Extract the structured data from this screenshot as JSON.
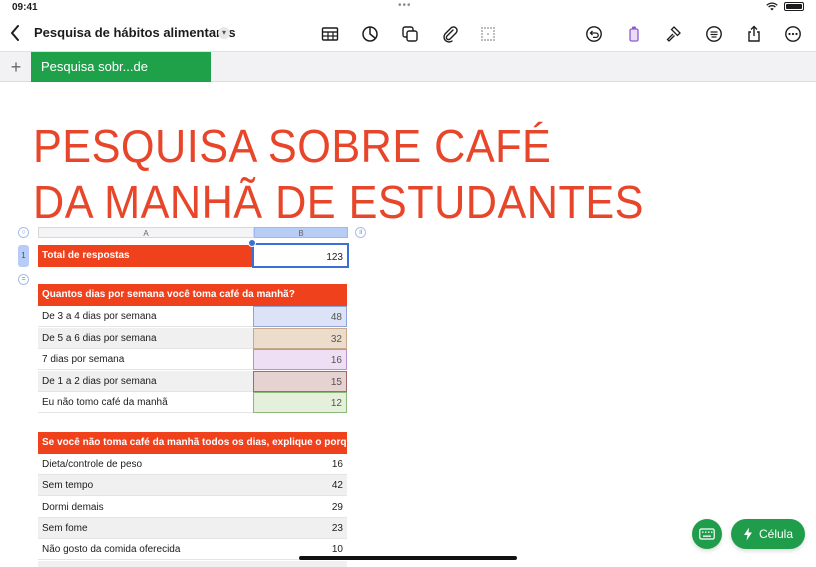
{
  "status": {
    "time": "09:41",
    "dots": "•••"
  },
  "toolbar": {
    "doc_title": "Pesquisa de hábitos alimentares",
    "icons": [
      "table-icon",
      "chart-icon",
      "shapes-icon",
      "attachment-icon",
      "grid-icon",
      "undo-icon",
      "format-brush-icon",
      "hammer-icon",
      "comment-list-icon",
      "share-icon",
      "more-icon"
    ]
  },
  "sheet": {
    "tab_label": "Pesquisa sobr...de estudantes"
  },
  "title": {
    "line1": "PESQUISA SOBRE CAFÉ",
    "line2": "DA MANHÃ DE ESTUDANTES"
  },
  "columns": {
    "a": "A",
    "b": "B",
    "row1": "1"
  },
  "table1": {
    "label": "Total de respostas",
    "value": "123"
  },
  "table2": {
    "header": "Quantos dias por semana você toma café da manhã?",
    "rows": [
      {
        "label": "De 3 a 4 dias por semana",
        "value": "48",
        "color": "#dde3f7",
        "border": "#8fa3d6"
      },
      {
        "label": "De 5 a 6 dias por semana",
        "value": "32",
        "color": "#ecdccb",
        "border": "#c9a98a"
      },
      {
        "label": "7 dias por semana",
        "value": "16",
        "color": "#efdff5",
        "border": "#b98fc8"
      },
      {
        "label": "De 1 a 2 dias por semana",
        "value": "15",
        "color": "#e6d2d0",
        "border": "#9e6b6b"
      },
      {
        "label": "Eu não tomo café da manhã",
        "value": "12",
        "color": "#e4f0dc",
        "border": "#8bb779"
      }
    ]
  },
  "table3": {
    "header": "Se você não toma café da manhã todos os dias, explique o porquê.",
    "rows": [
      {
        "label": "Dieta/controle de peso",
        "value": "16"
      },
      {
        "label": "Sem tempo",
        "value": "42"
      },
      {
        "label": "Dormi demais",
        "value": "29"
      },
      {
        "label": "Sem fome",
        "value": "23"
      },
      {
        "label": "Não gosto da comida oferecida",
        "value": "10"
      }
    ]
  },
  "actions": {
    "cell_label": "Célula"
  },
  "colors": {
    "accent_red": "#f0411d",
    "accent_green": "#1f9d4b",
    "selection_blue": "#3b6fd6"
  }
}
